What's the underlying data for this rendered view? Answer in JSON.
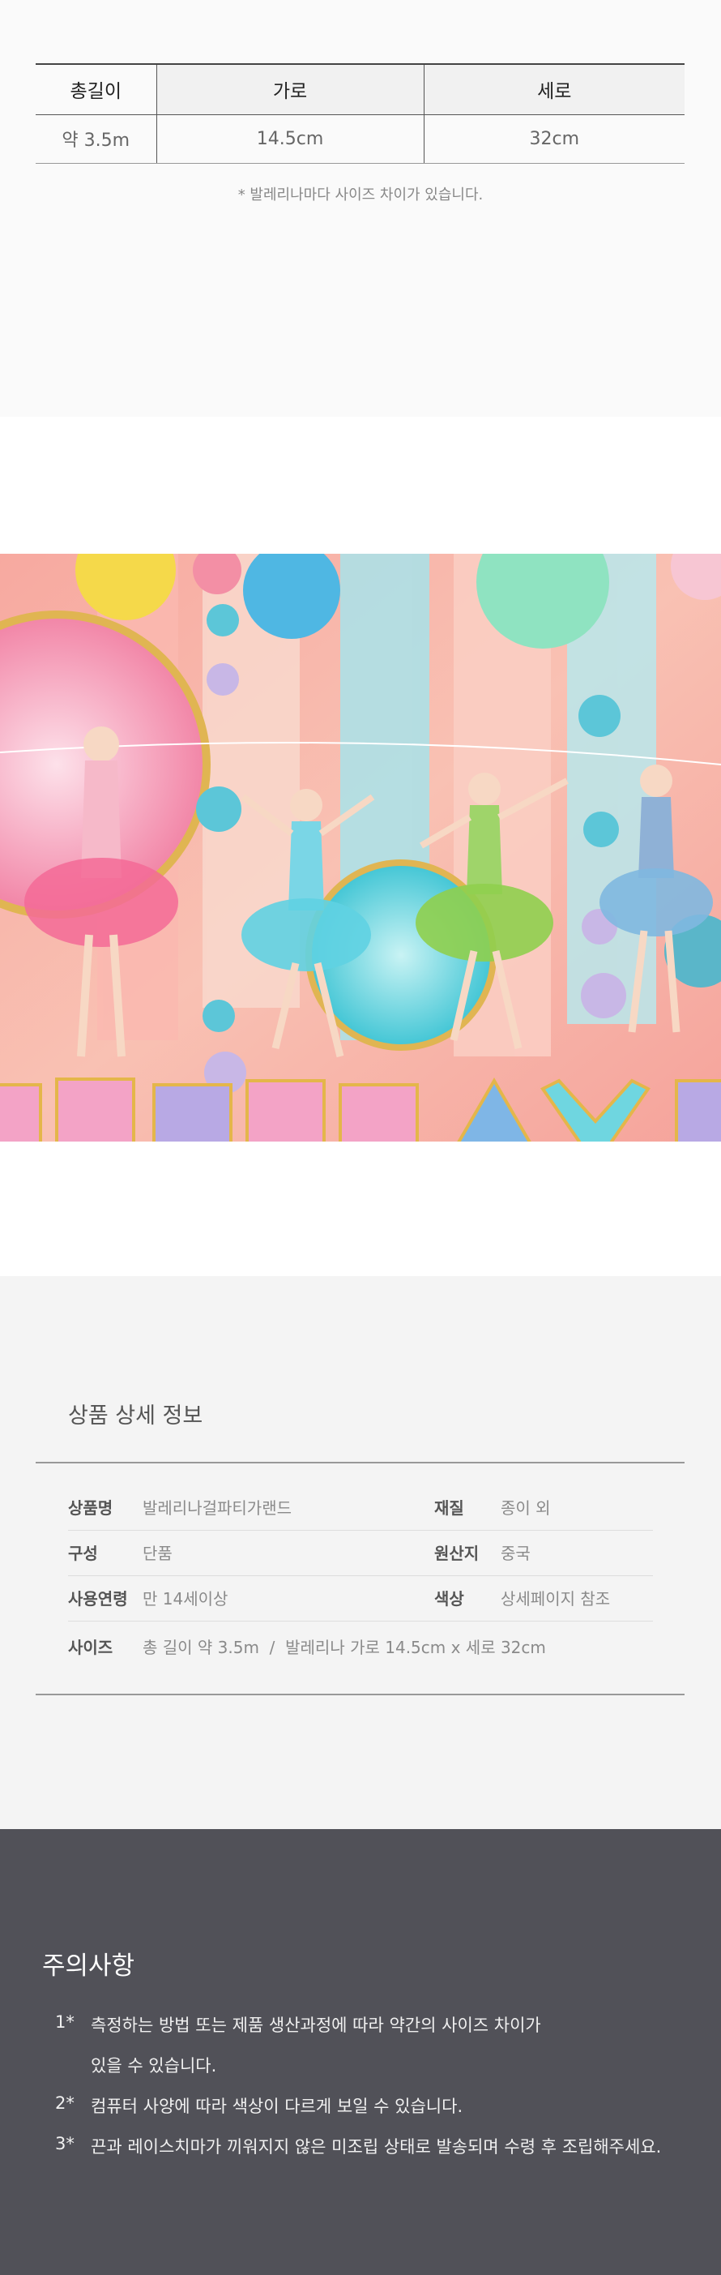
{
  "size_table": {
    "headers": [
      "총길이",
      "가로",
      "세로"
    ],
    "rows": [
      [
        "약 3.5m",
        "14.5cm",
        "32cm"
      ]
    ],
    "note": "* 발레리나마다 사이즈 차이가 있습니다."
  },
  "product_info": {
    "title": "상품 상세 정보",
    "rows": [
      {
        "label1": "상품명",
        "value1": "발레리나걸파티가랜드",
        "label2": "재질",
        "value2": "종이 외"
      },
      {
        "label1": "구성",
        "value1": "단품",
        "label2": "원산지",
        "value2": "중국"
      },
      {
        "label1": "사용연령",
        "value1": "만 14세이상",
        "label2": "색상",
        "value2": "상세페이지 참조"
      }
    ],
    "size_row": {
      "label": "사이즈",
      "value": "총 길이 약 3.5m  /  발레리나 가로 14.5cm x 세로 32cm"
    }
  },
  "caution": {
    "title": "주의사항",
    "items": [
      {
        "num": "1*",
        "line1": "측정하는 방법 또는 제품 생산과정에 따라 약간의 사이즈 차이가",
        "line2": "있을 수 있습니다."
      },
      {
        "num": "2*",
        "line1": "컴퓨터 사양에 따라 색상이 다르게 보일 수 있습니다."
      },
      {
        "num": "3*",
        "line1": "끈과 레이스치마가 끼워지지 않은 미조립 상태로 발송되며 수령 후 조립해주세요."
      }
    ]
  },
  "colors": {
    "caution_bg": "#515158",
    "info_bg": "#f4f4f4",
    "size_bg": "#fafafa"
  }
}
